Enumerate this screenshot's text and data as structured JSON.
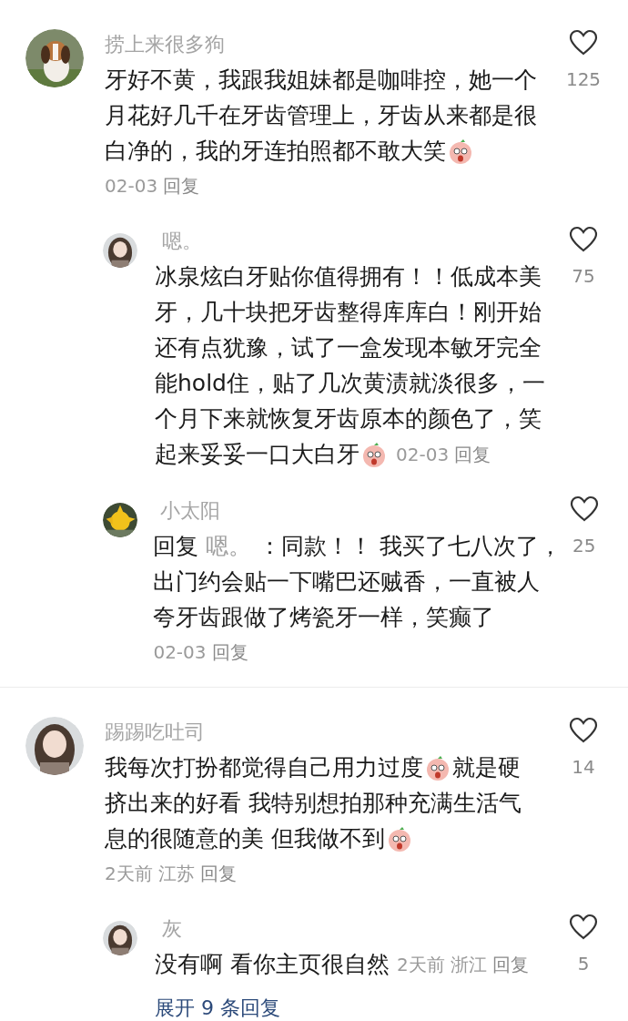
{
  "threads": [
    {
      "comment": {
        "user": "捞上来很多狗",
        "lines": [
          [
            {
              "kind": "text",
              "text": "牙好不黄，我跟我姐妹都是咖啡控，她一个"
            }
          ],
          [
            {
              "kind": "text",
              "text": "月花好几千在牙齿管理上，牙齿从来都是很"
            }
          ],
          [
            {
              "kind": "text",
              "text": "白净的，我的牙连拍照都不敢大笑"
            },
            {
              "kind": "emoji"
            }
          ]
        ],
        "meta": {
          "time": "02-03",
          "reply": "回复"
        },
        "meta_inline": false,
        "likes": "125"
      },
      "replies": [
        {
          "user": "嗯。",
          "lines": [
            [
              {
                "kind": "text",
                "text": "冰泉炫白牙贴你值得拥有！！低成本美"
              }
            ],
            [
              {
                "kind": "text",
                "text": "牙，几十块把牙齿整得库库白！刚开始"
              }
            ],
            [
              {
                "kind": "text",
                "text": "还有点犹豫，试了一盒发现本敏牙完全"
              }
            ],
            [
              {
                "kind": "text",
                "text": "能hold住，贴了几次黄渍就淡很多，一"
              }
            ],
            [
              {
                "kind": "text",
                "text": "个月下来就恢复牙齿原本的颜色了，笑"
              }
            ],
            [
              {
                "kind": "text",
                "text": "起来妥妥一口大白牙"
              },
              {
                "kind": "emoji"
              }
            ]
          ],
          "meta": {
            "time": "02-03",
            "reply": "回复"
          },
          "meta_inline": true,
          "likes": "75"
        },
        {
          "user": "小太阳",
          "lines": [
            [
              {
                "kind": "text",
                "text": "回复"
              },
              {
                "kind": "mention",
                "text": "嗯。"
              },
              {
                "kind": "text",
                "text": "：同款！！ 我买了七八次了，"
              }
            ],
            [
              {
                "kind": "text",
                "text": "出门约会贴一下嘴巴还贼香，一直被人"
              }
            ],
            [
              {
                "kind": "text",
                "text": "夸牙齿跟做了烤瓷牙一样，笑癫了"
              }
            ]
          ],
          "meta": {
            "time": "02-03",
            "reply": "回复"
          },
          "meta_inline": false,
          "likes": "25"
        }
      ]
    },
    {
      "comment": {
        "user": "踢踢吃吐司",
        "lines": [
          [
            {
              "kind": "text",
              "text": "我每次打扮都觉得自己用力过度"
            },
            {
              "kind": "emoji"
            },
            {
              "kind": "text",
              "text": " 就是硬"
            }
          ],
          [
            {
              "kind": "text",
              "text": "挤出来的好看 我特别想拍那种充满生活气"
            }
          ],
          [
            {
              "kind": "text",
              "text": "息的很随意的美 但我做不到"
            },
            {
              "kind": "emoji"
            }
          ]
        ],
        "meta": {
          "time": "2天前",
          "location": "江苏",
          "reply": "回复"
        },
        "meta_inline": false,
        "likes": "14"
      },
      "replies": [
        {
          "user": "灰",
          "lines": [
            [
              {
                "kind": "text",
                "text": "没有啊 看你主页很自然"
              }
            ]
          ],
          "meta": {
            "time": "2天前",
            "location": "浙江",
            "reply": "回复"
          },
          "meta_inline": true,
          "likes": "5"
        }
      ],
      "expand": "展开 9 条回复"
    }
  ]
}
